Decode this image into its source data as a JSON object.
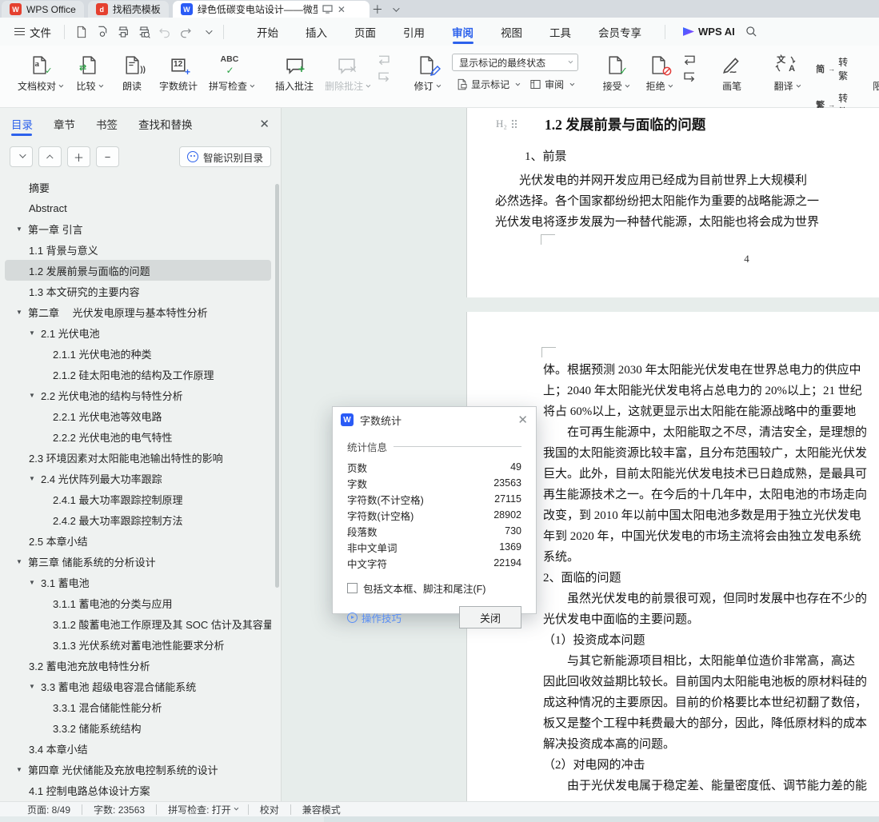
{
  "icons": {
    "close": "✕",
    "plus": "＋",
    "minus": "−",
    "new_tab": "＋",
    "monitor": "🖵",
    "search": "search-magnifier",
    "minus_btn": "−"
  },
  "tabbar": {
    "home_tab": "WPS Office",
    "docer_tab": "找稻壳模板",
    "doc_tab": "绿色低碳变电站设计——微型"
  },
  "menubar": {
    "file_label": "文件",
    "items": [
      {
        "label": "开始"
      },
      {
        "label": "插入"
      },
      {
        "label": "页面"
      },
      {
        "label": "引用"
      },
      {
        "label": "审阅",
        "active": true
      },
      {
        "label": "视图"
      },
      {
        "label": "工具"
      },
      {
        "label": "会员专享"
      }
    ],
    "wps_ai_label": "WPS AI"
  },
  "ribbon": {
    "doc_proof": "文档校对",
    "compare": "比较",
    "read_aloud": "朗读",
    "word_count": "字数统计",
    "spell_check": "拼写检查",
    "insert_comment": "插入批注",
    "delete_comment": "删除批注",
    "track_changes": "修订",
    "markup_state": "显示标记的最终状态",
    "show_markup": "显示标记",
    "review": "审阅",
    "accept": "接受",
    "reject": "拒绝",
    "pen": "画笔",
    "translate": "翻译",
    "s2t_glyph": "简",
    "s2t_label": "转繁",
    "t2s_glyph": "繁",
    "t2s_label": "转简",
    "restrict_edit": "限制编辑"
  },
  "sidebar": {
    "tabs": [
      {
        "label": "目录",
        "active": true
      },
      {
        "label": "章节"
      },
      {
        "label": "书签"
      },
      {
        "label": "查找和替换"
      }
    ],
    "smart_button": "智能识别目录",
    "toc": [
      {
        "text": "摘要",
        "level": 2
      },
      {
        "text": "Abstract",
        "level": 2
      },
      {
        "text": "第一章 引言",
        "level": 1,
        "arrow": true
      },
      {
        "text": "1.1 背景与意义",
        "level": 2
      },
      {
        "text": "1.2 发展前景与面临的问题",
        "level": 2,
        "selected": true
      },
      {
        "text": "1.3 本文研究的主要内容",
        "level": 2
      },
      {
        "text": "第二章　 光伏发电原理与基本特性分析",
        "level": 1,
        "arrow": true
      },
      {
        "text": "2.1 光伏电池",
        "level": 2,
        "arrow": true
      },
      {
        "text": "2.1.1 光伏电池的种类",
        "level": 3
      },
      {
        "text": "2.1.2 硅太阳电池的结构及工作原理",
        "level": 3
      },
      {
        "text": "2.2 光伏电池的结构与特性分析",
        "level": 2,
        "arrow": true
      },
      {
        "text": "2.2.1 光伏电池等效电路",
        "level": 3
      },
      {
        "text": "2.2.2 光伏电池的电气特性",
        "level": 3
      },
      {
        "text": "2.3 环境因素对太阳能电池输出特性的影响",
        "level": 2
      },
      {
        "text": "2.4 光伏阵列最大功率跟踪",
        "level": 2,
        "arrow": true
      },
      {
        "text": "2.4.1 最大功率跟踪控制原理",
        "level": 3
      },
      {
        "text": "2.4.2 最大功率跟踪控制方法",
        "level": 3
      },
      {
        "text": "2.5 本章小结",
        "level": 2
      },
      {
        "text": "第三章 储能系统的分析设计",
        "level": 1,
        "arrow": true
      },
      {
        "text": "3.1 蓄电池",
        "level": 2,
        "arrow": true
      },
      {
        "text": "3.1.1 蓄电池的分类与应用",
        "level": 3
      },
      {
        "text": "3.1.2 酸蓄电池工作原理及其 SOC 估计及其容量 ...",
        "level": 3
      },
      {
        "text": "3.1.3 光伏系统对蓄电池性能要求分析",
        "level": 3
      },
      {
        "text": "3.2 蓄电池充放电特性分析",
        "level": 2
      },
      {
        "text": "3.3 蓄电池 超级电容混合储能系统",
        "level": 2,
        "arrow": true
      },
      {
        "text": "3.3.1 混合储能性能分析",
        "level": 3
      },
      {
        "text": "3.3.2 储能系统结构",
        "level": 3
      },
      {
        "text": "3.4 本章小结",
        "level": 2
      },
      {
        "text": "第四章 光伏储能及充放电控制系统的设计",
        "level": 1,
        "arrow": true
      },
      {
        "text": "4.1 控制电路总体设计方案",
        "level": 2
      }
    ]
  },
  "document": {
    "h2_badge": "H₂",
    "heading": "1.2 发展前景与面临的问题",
    "subhead1": "1、前景",
    "page1_lines": [
      "　　光伏发电的并网开发应用已经成为目前世界上大规模利",
      "必然选择。各个国家都纷纷把太阳能作为重要的战略能源之一",
      "光伏发电将逐步发展为一种替代能源，太阳能也将会成为世界"
    ],
    "page1_number": "4",
    "page2_lines": [
      "体。根据预测 2030 年太阳能光伏发电在世界总电力的供应中",
      "上；2040 年太阳能光伏发电将占总电力的 20%以上；21 世纪",
      "将占 60%以上，这就更显示出太阳能在能源战略中的重要地",
      "　　在可再生能源中，太阳能取之不尽，清洁安全，是理想的",
      "我国的太阳能资源比较丰富，且分布范围较广，太阳能光伏发",
      "巨大。此外，目前太阳能光伏发电技术已日趋成熟，是最具可",
      "再生能源技术之一。在今后的十几年中，太阳电池的市场走向",
      "改变，到 2010 年以前中国太阳电池多数是用于独立光伏发电",
      "年到 2020 年，中国光伏发电的市场主流将会由独立发电系统",
      "系统。",
      "2、面临的问题",
      "　　虽然光伏发电的前景很可观，但同时发展中也存在不少的",
      "光伏发电中面临的主要问题。",
      "（1）投资成本问题",
      "　　与其它新能源项目相比，太阳能单位造价非常高，高达",
      "因此回收效益期比较长。目前国内太阳能电池板的原材料硅的",
      "成这种情况的主要原因。目前的价格要比本世纪初翻了数倍，",
      "板又是整个工程中耗费最大的部分，因此，降低原材料的成本",
      "解决投资成本高的问题。",
      "（2）对电网的冲击",
      "　　由于光伏发电属于稳定差、能量密度低、调节能力差的能"
    ]
  },
  "dialog": {
    "title": "字数统计",
    "section": "统计信息",
    "rows": [
      {
        "label": "页数",
        "value": "49"
      },
      {
        "label": "字数",
        "value": "23563"
      },
      {
        "label": "字符数(不计空格)",
        "value": "27115"
      },
      {
        "label": "字符数(计空格)",
        "value": "28902"
      },
      {
        "label": "段落数",
        "value": "730"
      },
      {
        "label": "非中文单词",
        "value": "1369"
      },
      {
        "label": "中文字符",
        "value": "22194"
      }
    ],
    "checkbox_label": "包括文本框、脚注和尾注(F)",
    "tips_label": "操作技巧",
    "close_button": "关闭"
  },
  "statusbar": {
    "items": [
      {
        "label": "页面: 8/49"
      },
      {
        "label": "字数: 23563"
      },
      {
        "label": "拼写检查: 打开",
        "chevron": true
      },
      {
        "label": "校对"
      },
      {
        "label": "兼容模式"
      }
    ]
  }
}
